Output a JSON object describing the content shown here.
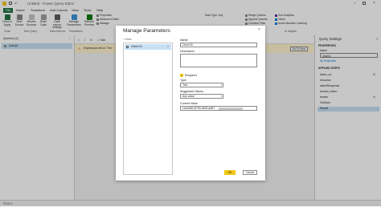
{
  "window": {
    "title": "Untitled - Power Query Editor"
  },
  "ribbon_tabs": [
    "File",
    "Home",
    "Transform",
    "Add Column",
    "View",
    "Tools",
    "Help"
  ],
  "ribbon": {
    "close_apply": "Close & Apply",
    "new_source": "New Source",
    "recent_sources": "Recent Sources",
    "enter_data": "Enter Data",
    "data_source_settings": "Data source settings",
    "manage_parameters": "Manage Parameters",
    "refresh_preview": "Refresh Preview",
    "properties": "Properties",
    "advanced_editor": "Advanced Editor",
    "manage": "Manage",
    "data_type": "Data Type: Any",
    "merge_queries": "Merge Queries",
    "append_queries": "Append Queries",
    "combine_files": "Combine Files",
    "text_analytics": "Text Analytics",
    "vision": "Vision",
    "azure_ml": "Azure Machine Learning",
    "groups": {
      "close": "Close",
      "new_query": "New Query",
      "data_sources": "Data Sources",
      "parameters": "Parameters",
      "ai_insights": "AI Insights"
    }
  },
  "left_pane": {
    "header": "Queries [1]",
    "query": "Query1"
  },
  "formula_bar": {
    "prefix": "fx",
    "text": "= Tab"
  },
  "warning": {
    "text": "Expression.Error: The",
    "button": "Go To Error"
  },
  "right_pane": {
    "title": "Query Settings",
    "properties_header": "PROPERTIES",
    "name_label": "Name",
    "name_value": "Query1",
    "all_properties": "All Properties",
    "applied_steps_header": "APPLIED STEPS",
    "steps": [
      "token_uri",
      "resource",
      "tokenResponse",
      "access_token",
      "bearer",
      "GetJson",
      "Result"
    ]
  },
  "status": {
    "text": "READY"
  },
  "dialog": {
    "title": "Manage Parameters",
    "new_label": "New",
    "param_item": "Client ID",
    "name_label": "Name",
    "name_value": "Client ID",
    "description_label": "Description",
    "required_label": "Required",
    "type_label": "Type",
    "type_value": "Text",
    "suggested_label": "Suggested Values",
    "suggested_value": "Any value",
    "current_label": "Current Value",
    "current_value": "cde10f62-8794-4625-a587-",
    "ok": "OK",
    "cancel": "Cancel"
  },
  "colors": {
    "accent": "#217346",
    "ok_button": "#f2c811",
    "warning_bg": "#fff4ce"
  }
}
